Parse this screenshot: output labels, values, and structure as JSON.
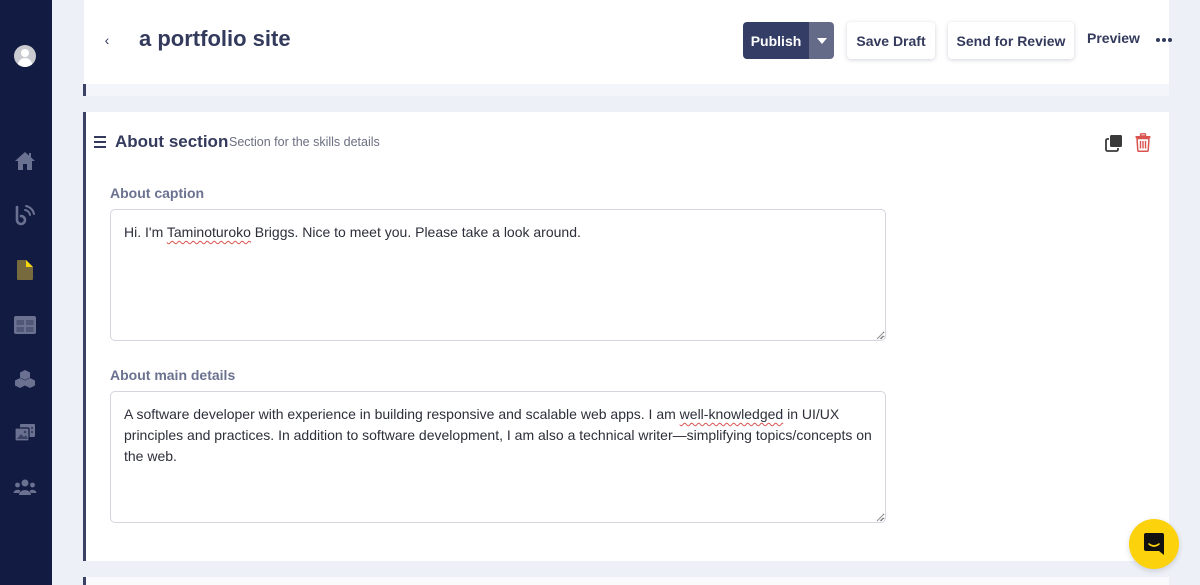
{
  "sidebar": {
    "items": [
      {
        "id": "home",
        "icon": "home-icon"
      },
      {
        "id": "blog",
        "icon": "blog-feed-icon"
      },
      {
        "id": "pages",
        "icon": "document-icon",
        "active": true
      },
      {
        "id": "layout",
        "icon": "grid-layout-icon"
      },
      {
        "id": "components",
        "icon": "cubes-icon"
      },
      {
        "id": "media",
        "icon": "media-gallery-icon"
      },
      {
        "id": "team",
        "icon": "users-icon"
      }
    ],
    "active_color": "#f5d90a"
  },
  "header": {
    "back_label": "‹",
    "title": "a portfolio site",
    "publish_label": "Publish",
    "save_draft_label": "Save Draft",
    "send_review_label": "Send for Review",
    "preview_label": "Preview",
    "more_label": "More options"
  },
  "section": {
    "title": "About section",
    "description": "Section for the skills details",
    "fields": [
      {
        "label": "About caption",
        "value_parts": [
          "Hi. I'm ",
          "Taminoturoko",
          " Briggs. Nice to meet you. Please take a look around."
        ]
      },
      {
        "label": "About main details",
        "value_parts": [
          "A software developer with experience in building responsive and scalable web apps. I am ",
          "well-knowledged",
          " in UI/UX principles and practices. In addition to software development, I am also a technical writer—simplifying topics/concepts on the web."
        ]
      }
    ]
  },
  "colors": {
    "sidebar_bg": "#121b41",
    "primary": "#333d66",
    "delete": "#d9534f",
    "chat": "#fcd20c"
  }
}
